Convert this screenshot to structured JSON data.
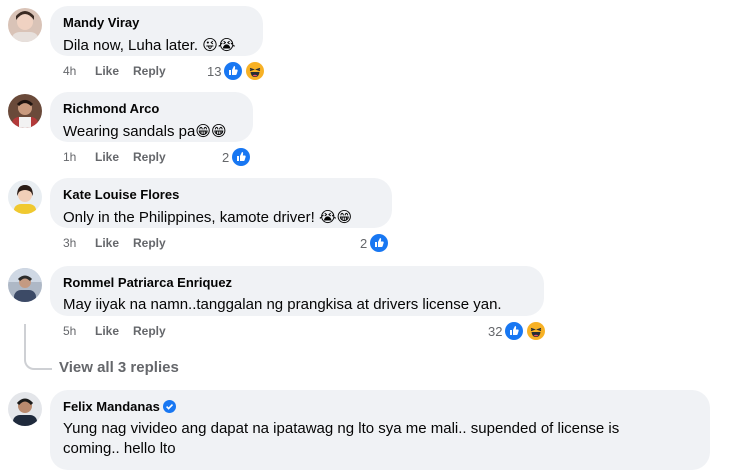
{
  "comments": [
    {
      "name": "Mandy Viray",
      "text": "Dila now, Luha later. ",
      "emoji": "😜😭",
      "time": "4h",
      "like": "Like",
      "reply": "Reply",
      "reaction_count": "13",
      "reactions": [
        "like",
        "haha"
      ]
    },
    {
      "name": "Richmond Arco",
      "text": "Wearing sandals pa",
      "emoji": "😁😁",
      "time": "1h",
      "like": "Like",
      "reply": "Reply",
      "reaction_count": "2",
      "reactions": [
        "like"
      ]
    },
    {
      "name": "Kate Louise Flores",
      "text": "Only in the Philippines, kamote driver! ",
      "emoji": "😭😁",
      "time": "3h",
      "like": "Like",
      "reply": "Reply",
      "reaction_count": "2",
      "reactions": [
        "like"
      ]
    },
    {
      "name": "Rommel Patriarca Enriquez",
      "text": "May iiyak na namn..tanggalan ng prangkisa at drivers license yan.",
      "time": "5h",
      "like": "Like",
      "reply": "Reply",
      "reaction_count": "32",
      "reactions": [
        "like",
        "haha"
      ]
    },
    {
      "name": "Felix Mandanas",
      "verified": true,
      "text_line1": "Yung nag vivideo ang dapat na ipatawag ng lto sya me mali.. supended of license is",
      "text_line2": "coming.. hello lto"
    }
  ],
  "view_replies": "View all 3 replies",
  "colors": {
    "bubble": "#f0f2f5",
    "name": "#050505",
    "meta": "#65676b",
    "like_blue": "#1877f2",
    "haha_yellow": "#f7b125"
  }
}
